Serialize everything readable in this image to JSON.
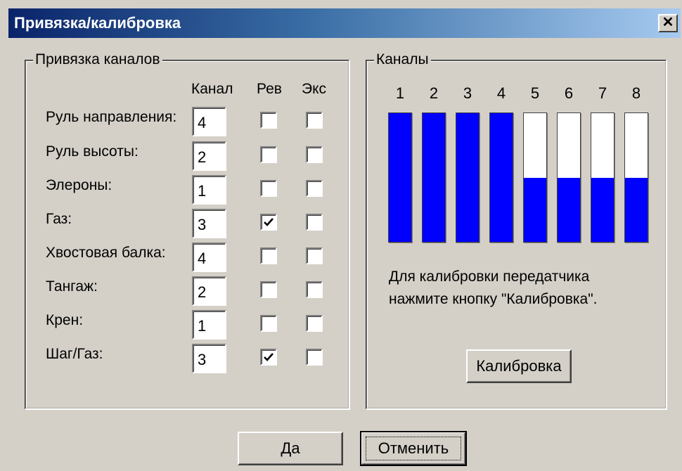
{
  "window": {
    "title": "Привязка/калибровка",
    "close_glyph": "✕"
  },
  "binding_group": {
    "title": "Привязка каналов",
    "col_channel": "Канал",
    "col_rev": "Рев",
    "col_exp": "Экс",
    "rows": [
      {
        "label": "Руль направления:",
        "channel": "4",
        "rev": false,
        "exp": false
      },
      {
        "label": "Руль высоты:",
        "channel": "2",
        "rev": false,
        "exp": false
      },
      {
        "label": "Элероны:",
        "channel": "1",
        "rev": false,
        "exp": false
      },
      {
        "label": "Газ:",
        "channel": "3",
        "rev": true,
        "exp": false
      },
      {
        "label": "Хвостовая балка:",
        "channel": "4",
        "rev": false,
        "exp": false
      },
      {
        "label": "Тангаж:",
        "channel": "2",
        "rev": false,
        "exp": false
      },
      {
        "label": "Крен:",
        "channel": "1",
        "rev": false,
        "exp": false
      },
      {
        "label": "Шаг/Газ:",
        "channel": "3",
        "rev": true,
        "exp": false
      }
    ]
  },
  "channels_group": {
    "title": "Каналы",
    "bar_color": "#0000ff",
    "bars": [
      {
        "number": "1",
        "level": 1.0
      },
      {
        "number": "2",
        "level": 1.0
      },
      {
        "number": "3",
        "level": 1.0
      },
      {
        "number": "4",
        "level": 1.0
      },
      {
        "number": "5",
        "level": 0.5
      },
      {
        "number": "6",
        "level": 0.5
      },
      {
        "number": "7",
        "level": 0.5
      },
      {
        "number": "8",
        "level": 0.5
      }
    ],
    "info_line1": "Для калибровки передатчика",
    "info_line2": "нажмите кнопку \"Калибровка\".",
    "calibrate_label": "Калибровка"
  },
  "footer": {
    "ok_label": "Да",
    "cancel_label": "Отменить"
  }
}
